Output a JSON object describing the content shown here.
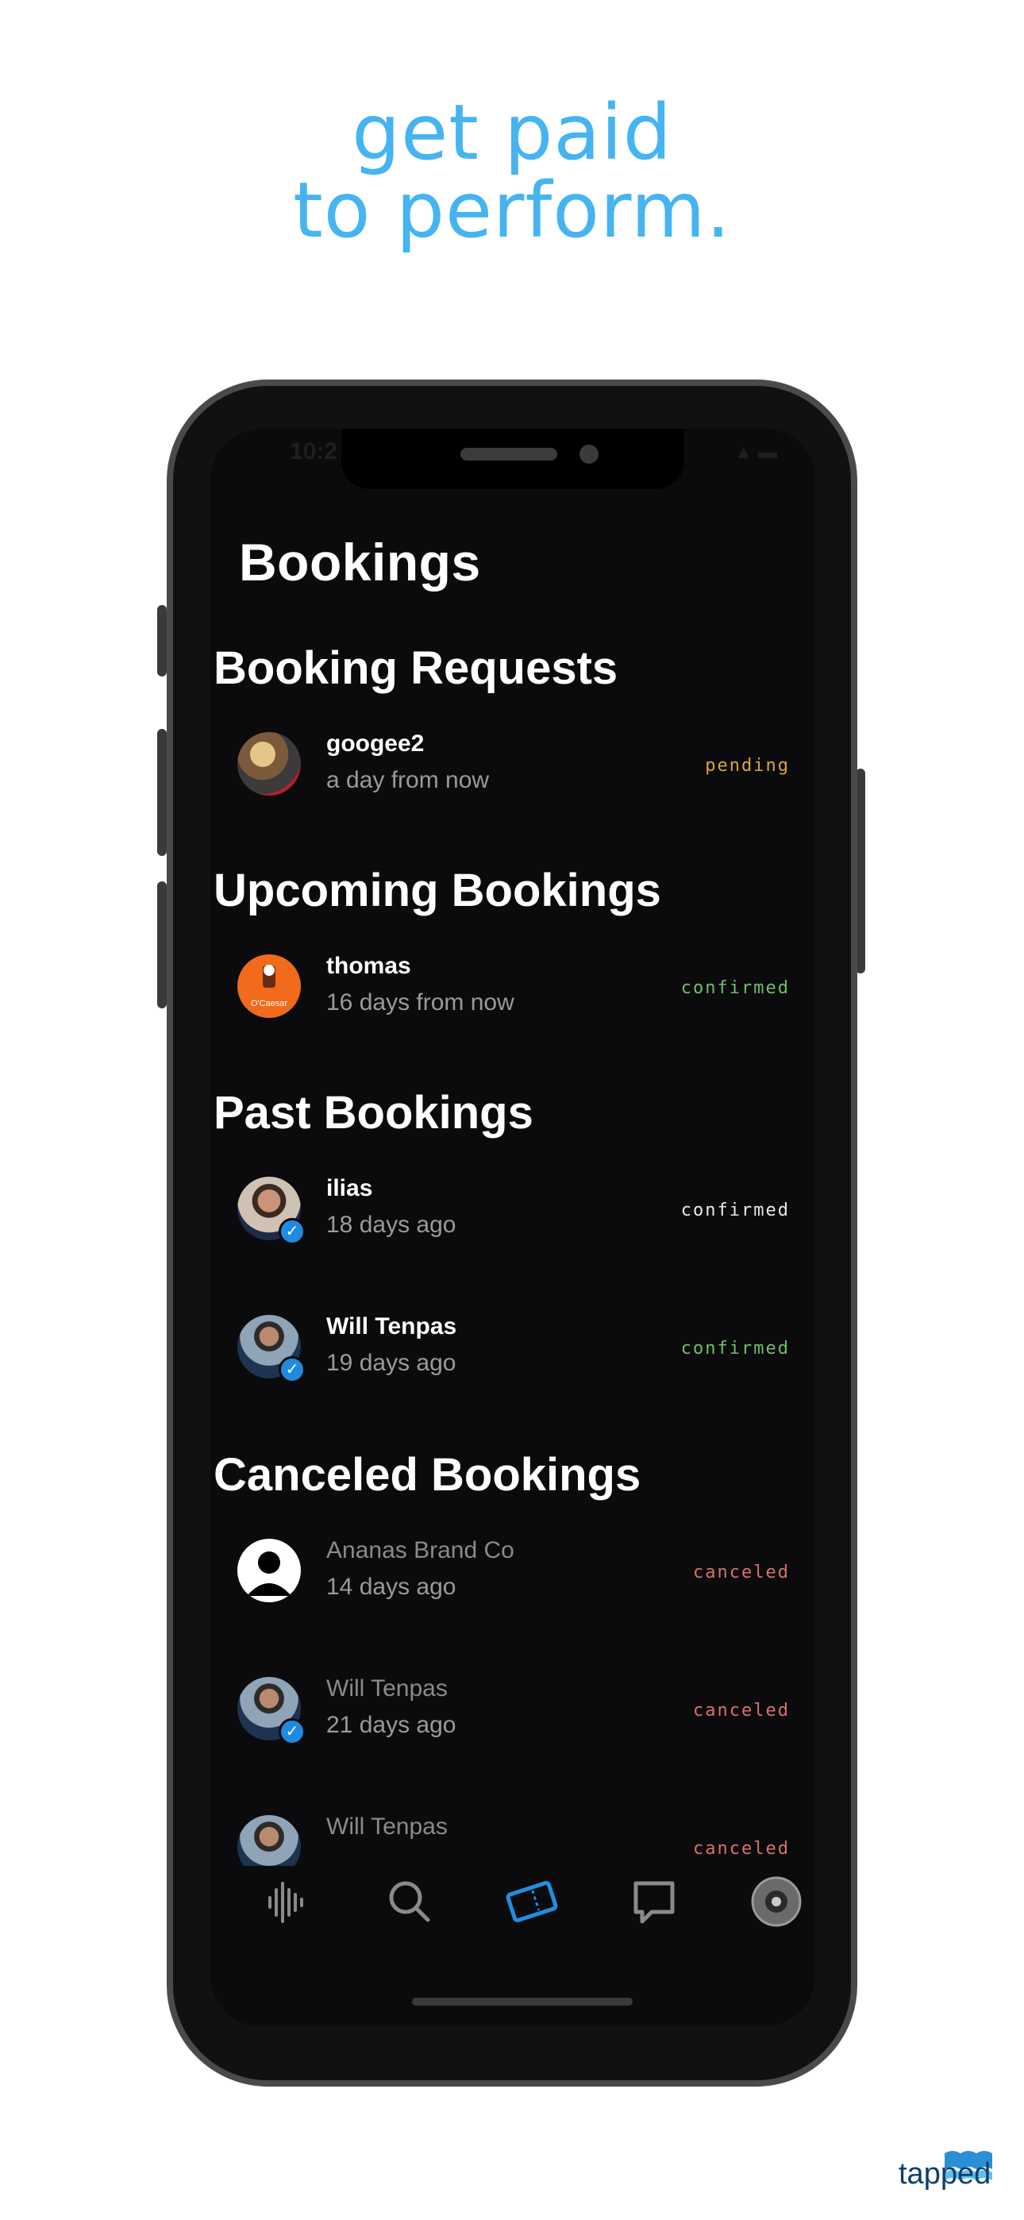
{
  "headline": {
    "line1": "get paid",
    "line2": "to perform."
  },
  "status_bar": {
    "time": "10:2",
    "icons": "▲ ▬"
  },
  "page_title": "Bookings",
  "sections": {
    "requests": {
      "title": "Booking Requests"
    },
    "upcoming": {
      "title": "Upcoming Bookings"
    },
    "past": {
      "title": "Past Bookings"
    },
    "canceled": {
      "title": "Canceled Bookings"
    }
  },
  "rows": [
    {
      "name": "googee2",
      "when": "a day from now",
      "status": "pending",
      "status_color": "#d9a441"
    },
    {
      "name": "thomas",
      "when": "16 days from now",
      "status": "confirmed",
      "status_color": "#6fbf6a"
    },
    {
      "name": "ilias",
      "when": "18 days ago",
      "status": "confirmed",
      "status_color": "#e8e8e8"
    },
    {
      "name": "Will Tenpas",
      "when": "19 days ago",
      "status": "confirmed",
      "status_color": "#6fbf6a"
    },
    {
      "name": "Ananas Brand Co",
      "when": "14 days ago",
      "status": "canceled",
      "status_color": "#d9706a"
    },
    {
      "name": "Will Tenpas",
      "when": "21 days ago",
      "status": "canceled",
      "status_color": "#d9706a"
    },
    {
      "name": "Will Tenpas",
      "when": "",
      "status": "canceled",
      "status_color": "#d9706a"
    }
  ],
  "thomas_avatar_text": "O'Caesar",
  "tabs": [
    {
      "icon": "waveform-icon"
    },
    {
      "icon": "search-icon"
    },
    {
      "icon": "ticket-icon",
      "active": true
    },
    {
      "icon": "chat-icon"
    },
    {
      "icon": "profile-avatar"
    }
  ],
  "colors": {
    "accent": "#45b4f0",
    "active_tab": "#1f8fe0",
    "background": "#0b0b0d"
  },
  "logo": {
    "text": "tapped"
  }
}
